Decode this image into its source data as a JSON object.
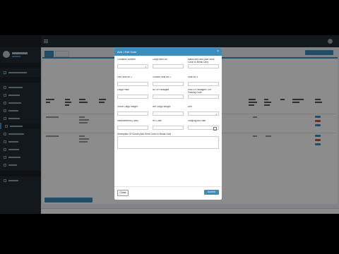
{
  "app": {
    "brand": ""
  },
  "topbar": {
    "user_name": ""
  },
  "sidebar": {
    "items": [
      "",
      "",
      "",
      "",
      "",
      "",
      "",
      "",
      "",
      "",
      "",
      "",
      ""
    ]
  },
  "table": {
    "headers": [
      "",
      "",
      "",
      "",
      "",
      "",
      "",
      "",
      "",
      "",
      "",
      ""
    ]
  },
  "modal": {
    "title": "Add / Edit Data",
    "close": "×",
    "fields": [
      {
        "label": "Container Number",
        "value": "",
        "type": "select"
      },
      {
        "label": "Cargo Item No",
        "value": "",
        "type": "text"
      },
      {
        "label": "Marks And Nos (Add Semi Colon to Break Line)",
        "value": "",
        "type": "text"
      },
      {
        "label": "Line Seal No 1",
        "value": "",
        "type": "text"
      },
      {
        "label": "Custom Seal No 2",
        "value": "",
        "type": "text"
      },
      {
        "label": "Seal No 3",
        "value": "",
        "type": "text"
      },
      {
        "label": "Cargo Pack",
        "value": "",
        "type": "text"
      },
      {
        "label": "No Of Packages",
        "value": "",
        "type": "text"
      },
      {
        "label": "Kind Of Packages / UN Packing Code",
        "value": "",
        "type": "text"
      },
      {
        "label": "Gross Cargo Weight",
        "value": "",
        "type": "text"
      },
      {
        "label": "Net Cargo Weight",
        "value": "",
        "type": "text"
      },
      {
        "label": "Unit",
        "value": "",
        "type": "select"
      },
      {
        "label": "Measurement (CBM)",
        "value": "",
        "type": "text"
      },
      {
        "label": "HS Code",
        "value": "",
        "type": "text"
      },
      {
        "label": "Shipping Bill Date",
        "value": "",
        "type": "date"
      }
    ],
    "description_label": "Description Of Goods (Add Semi Colon to Break Line)",
    "description_placeholder": "",
    "close_button": "Close",
    "submit_button": "Submit"
  },
  "colors": {
    "primary": "#3c8dbc",
    "sidebar": "#222d32",
    "danger": "#dd4b39"
  }
}
